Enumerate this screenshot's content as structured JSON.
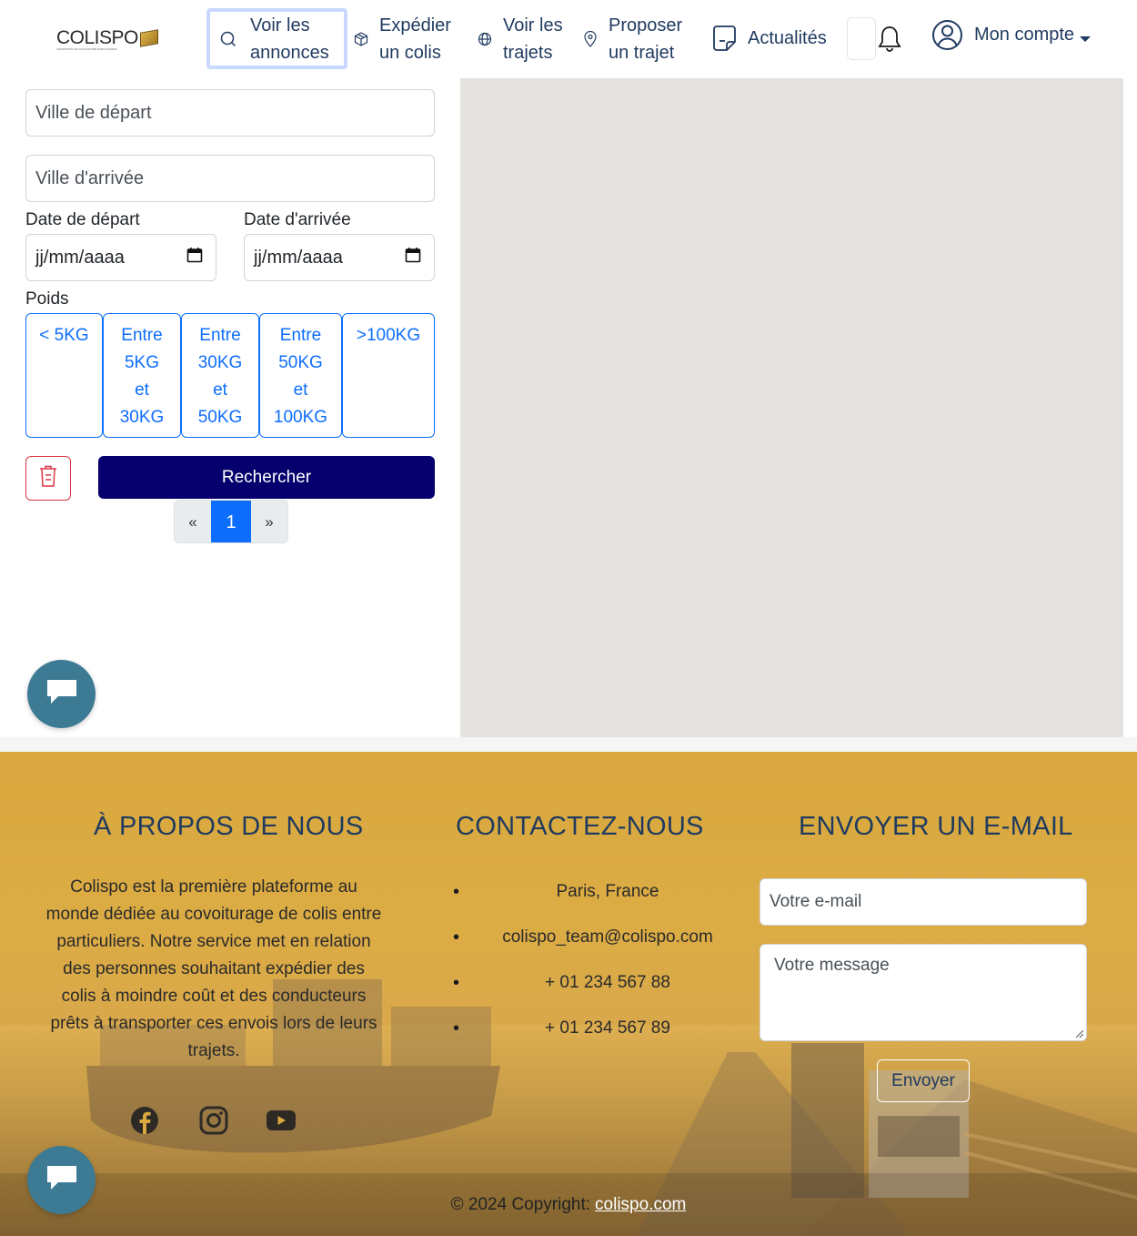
{
  "header": {
    "logo": "COLISPO",
    "logo_tagline": "TRANSPORT DE COLIS ENTRE PARTICULIERS",
    "nav": {
      "annonces_line1": "Voir les",
      "annonces_line2": "annonces",
      "expedier_line1": "Expédier",
      "expedier_line2": "un colis",
      "trajets_line1": "Voir les",
      "trajets_line2": "trajets",
      "proposer_line1": "Proposer",
      "proposer_line2": "un trajet",
      "actualites": "Actualités"
    },
    "account_label": "Mon compte"
  },
  "search": {
    "departure_city_placeholder": "Ville de départ",
    "arrival_city_placeholder": "Ville d'arrivée",
    "departure_date_label": "Date de départ",
    "arrival_date_label": "Date d'arrivée",
    "date_placeholder": "jj/mm/aaaa",
    "weight_label": "Poids",
    "weights": [
      {
        "line1": "< 5KG",
        "line2": "",
        "line3": "",
        "line4": ""
      },
      {
        "line1": "Entre",
        "line2": "5KG",
        "line3": "et",
        "line4": "30KG"
      },
      {
        "line1": "Entre",
        "line2": "30KG",
        "line3": "et",
        "line4": "50KG"
      },
      {
        "line1": "Entre",
        "line2": "50KG",
        "line3": "et",
        "line4": "100KG"
      },
      {
        "line1": ">100KG",
        "line2": "",
        "line3": "",
        "line4": ""
      }
    ],
    "search_button": "Rechercher"
  },
  "pagination": {
    "prev": "«",
    "current": "1",
    "next": "»"
  },
  "footer": {
    "about_title": "À PROPOS DE NOUS",
    "about_text": "Colispo est la première plateforme au monde dédiée au covoiturage de colis entre particuliers. Notre service met en relation des personnes souhaitant expédier des colis à moindre coût et des conducteurs prêts à transporter ces envois lors de leurs trajets.",
    "contact_title": "CONTACTEZ-NOUS",
    "contact_items": [
      "Paris, France",
      "colispo_team@colispo.com",
      "+ 01 234 567 88",
      "+ 01 234 567 89"
    ],
    "email_title": "ENVOYER UN E-MAIL",
    "email_placeholder": "Votre e-mail",
    "message_placeholder": "Votre message",
    "send_button": "Envoyer",
    "copyright": "© 2024 Copyright:",
    "copyright_link": "colispo.com"
  },
  "colors": {
    "nav_text": "#1f3a5f",
    "primary_blue": "#0d6efd",
    "search_button": "#06006e",
    "danger": "#dc3545",
    "chat_bubble": "#3d7a94",
    "footer_gold": "#d9a83f",
    "map_bg": "#e5e3df"
  },
  "icons": {
    "annonces": "search-icon",
    "expedier": "package-icon",
    "trajets": "globe-icon",
    "proposer": "map-pin-icon",
    "actualites": "document-icon",
    "notifications": "bell-icon",
    "account": "user-circle-icon",
    "reset": "trash-icon",
    "chat": "chat-icon",
    "social": [
      "facebook-icon",
      "instagram-icon",
      "youtube-icon"
    ]
  }
}
